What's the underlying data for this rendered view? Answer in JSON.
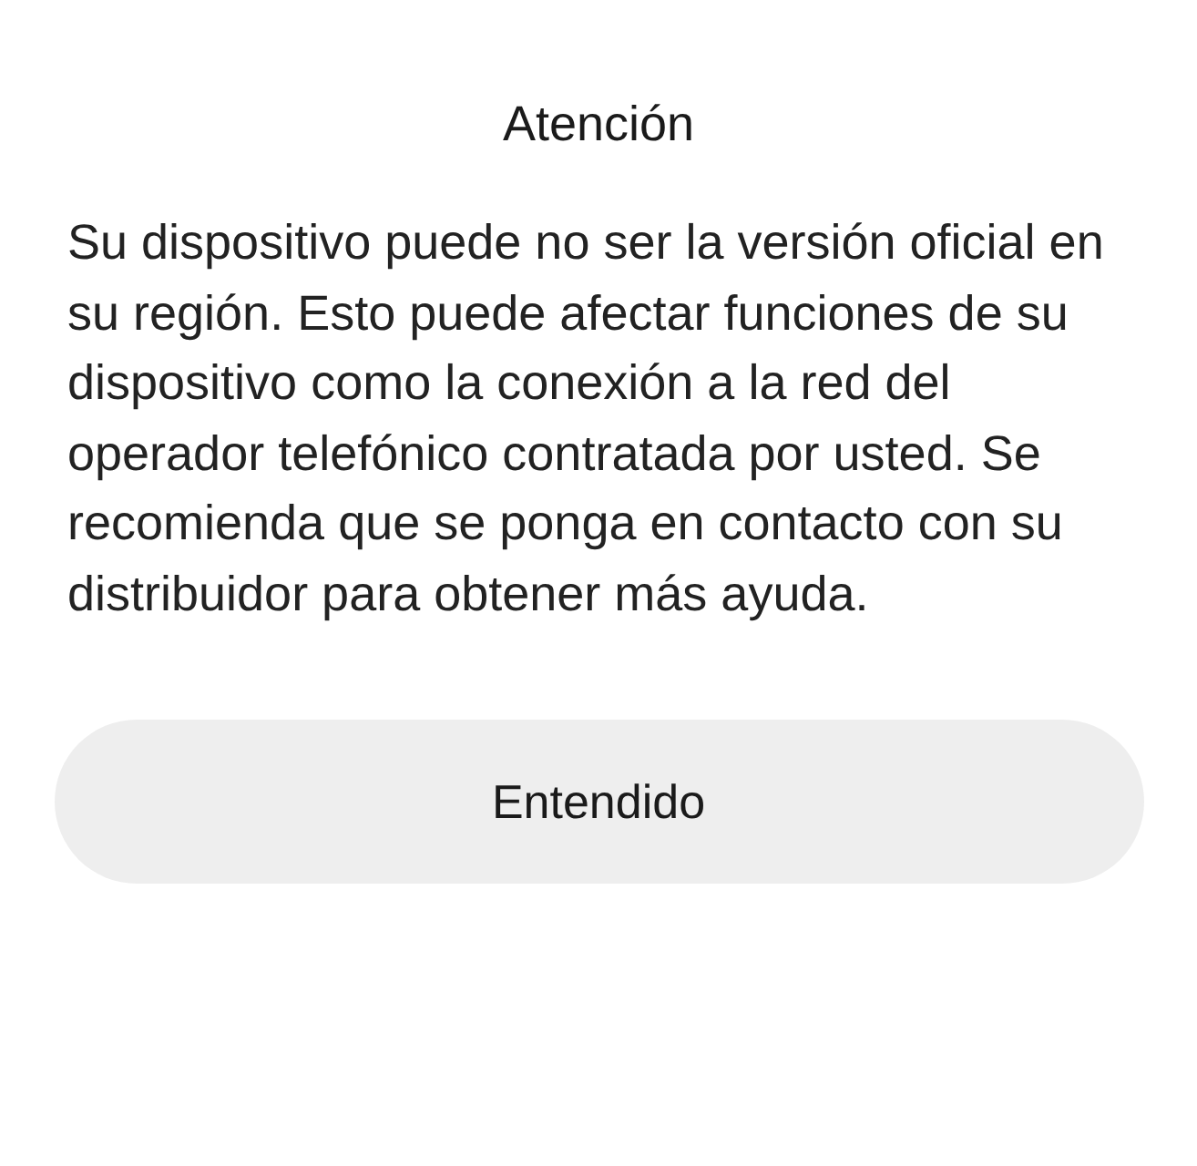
{
  "dialog": {
    "title": "Atención",
    "message": "Su dispositivo puede no ser la versión oficial en su región. Esto puede afectar funciones de su dispositivo como la conexión a la red del operador telefónico contratada por usted. Se recomienda que se ponga en contacto con su distribuidor para obtener más ayuda.",
    "buttons": [
      "Entendido"
    ]
  }
}
